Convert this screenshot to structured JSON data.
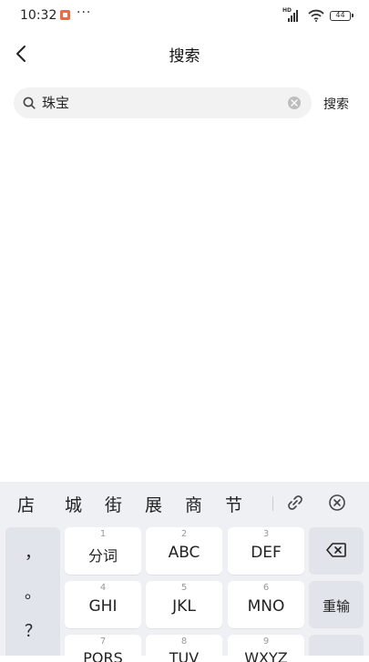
{
  "status_bar": {
    "time": "10:32",
    "more": "···",
    "network": "HD",
    "battery": "44"
  },
  "header": {
    "title": "搜索"
  },
  "search": {
    "value": "珠宝",
    "button_label": "搜索"
  },
  "keyboard": {
    "candidates": [
      "店",
      "城",
      "街",
      "展",
      "商",
      "节"
    ],
    "punctuation": [
      "，",
      "。",
      "？"
    ],
    "keys": [
      {
        "num": "1",
        "label": "分词"
      },
      {
        "num": "2",
        "label": "ABC"
      },
      {
        "num": "3",
        "label": "DEF"
      },
      {
        "num": "4",
        "label": "GHI"
      },
      {
        "num": "5",
        "label": "JKL"
      },
      {
        "num": "6",
        "label": "MNO"
      },
      {
        "num": "7",
        "label": "PQRS"
      },
      {
        "num": "8",
        "label": "TUV"
      },
      {
        "num": "9",
        "label": "WXYZ"
      }
    ],
    "reenter_label": "重输"
  }
}
